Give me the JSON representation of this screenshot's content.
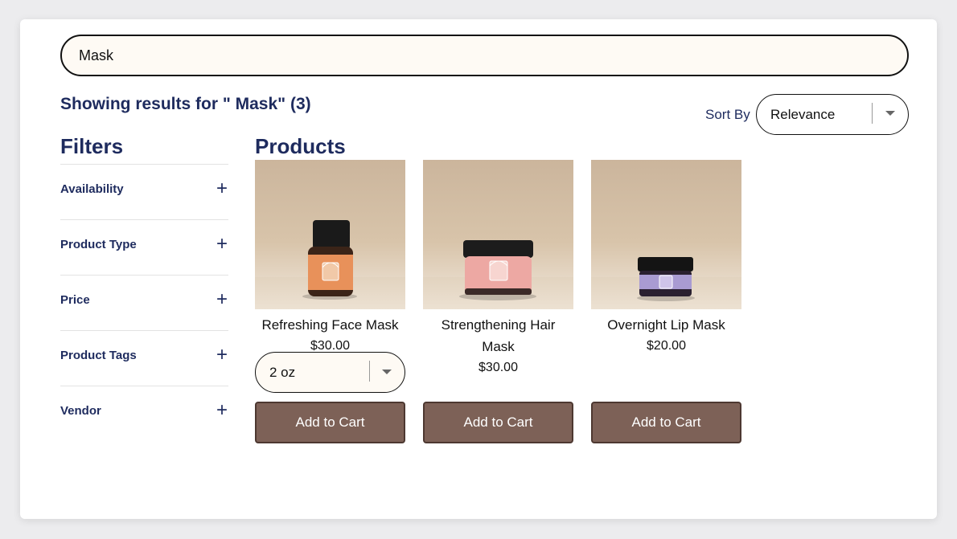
{
  "search": {
    "value": "Mask",
    "placeholder": ""
  },
  "results": {
    "heading": "Showing results for \" Mask\" (3)"
  },
  "sort": {
    "label": "Sort By",
    "selected": "Relevance"
  },
  "filters": {
    "title": "Filters",
    "items": [
      {
        "label": "Availability"
      },
      {
        "label": "Product Type"
      },
      {
        "label": "Price"
      },
      {
        "label": "Product Tags"
      },
      {
        "label": "Vendor"
      }
    ],
    "expand_icon": "plus-icon"
  },
  "products": {
    "title": "Products",
    "items": [
      {
        "name": "Refreshing Face Mask",
        "price": "$30.00",
        "variant": "2 oz",
        "cta": "Add to Cart",
        "label_color": "#e8915a"
      },
      {
        "name": "Strengthening Hair Mask",
        "price": "$30.00",
        "cta": "Add to Cart",
        "label_color": "#eda8a3"
      },
      {
        "name": "Overnight Lip Mask",
        "price": "$20.00",
        "cta": "Add to Cart",
        "label_color": "#a99bd2"
      }
    ]
  },
  "colors": {
    "brand_navy": "#1e2b5e",
    "button_brown": "#7d6157"
  }
}
